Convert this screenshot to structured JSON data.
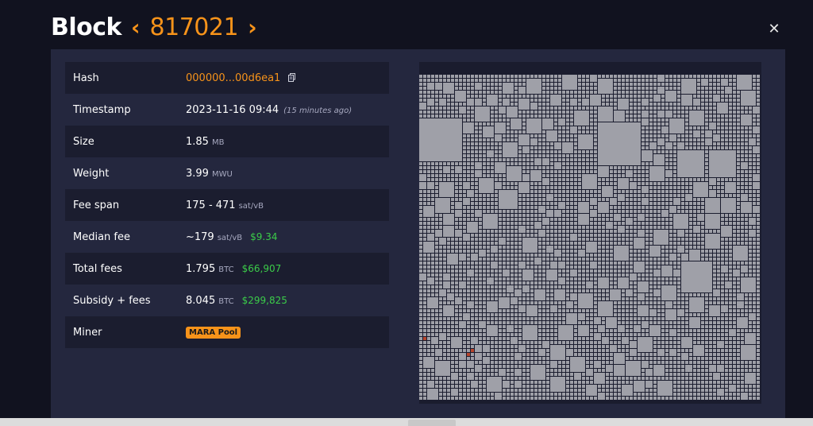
{
  "header": {
    "title": "Block",
    "prev_arrow": "‹",
    "next_arrow": "›",
    "block_height": "817021",
    "close_symbol": "✕"
  },
  "details": {
    "hash_label": "Hash",
    "hash_value": "000000...00d6ea1",
    "timestamp_label": "Timestamp",
    "timestamp_value": "2023-11-16 09:44",
    "timestamp_ago": "(15 minutes ago)",
    "size_label": "Size",
    "size_value": "1.85",
    "size_unit": "MB",
    "weight_label": "Weight",
    "weight_value": "3.99",
    "weight_unit": "MWU",
    "fee_span_label": "Fee span",
    "fee_span_value": "175 - 471",
    "fee_span_unit": "sat/vB",
    "median_fee_label": "Median fee",
    "median_fee_value": "~179",
    "median_fee_unit": "sat/vB",
    "median_fee_usd": "$9.34",
    "total_fees_label": "Total fees",
    "total_fees_value": "1.795",
    "total_fees_unit": "BTC",
    "total_fees_usd": "$66,907",
    "subsidy_label": "Subsidy + fees",
    "subsidy_value": "8.045",
    "subsidy_unit": "BTC",
    "subsidy_usd": "$299,825",
    "miner_label": "Miner",
    "miner_value": "MARA Pool"
  },
  "colors": {
    "accent": "#f7931a",
    "usd_green": "#3bcc49",
    "tx_square": "#9fa0a8",
    "highlight_tx": "#b8452c"
  },
  "icons": {
    "copy": "copy-icon",
    "close": "close-icon",
    "prev": "chevron-left-icon",
    "next": "chevron-right-icon"
  }
}
